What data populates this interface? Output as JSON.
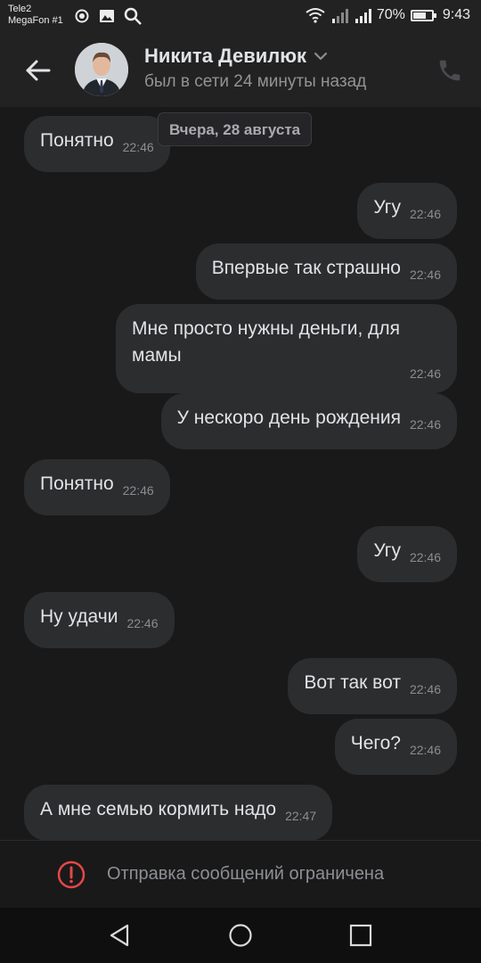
{
  "status_bar": {
    "carrier_1": "Tele2",
    "carrier_2": "MegaFon #1",
    "battery_percent": "70%",
    "battery_level": 0.7,
    "time": "9:43"
  },
  "header": {
    "contact_name": "Никита Девилюк",
    "last_seen": "был в сети 24 минуты назад"
  },
  "chat": {
    "date_chip": "Вчера, 28 августа",
    "messages": [
      {
        "side": "in",
        "text": "Понятно",
        "time": "22:46"
      },
      {
        "side": "out",
        "text": "Угу",
        "time": "22:46"
      },
      {
        "side": "out",
        "text": "Впервые так страшно",
        "time": "22:46"
      },
      {
        "side": "out",
        "text": "Мне просто нужны деньги, для мамы",
        "time": "22:46"
      },
      {
        "side": "out",
        "text": "У нескоро день рождения",
        "time": "22:46"
      },
      {
        "side": "in",
        "text": "Понятно",
        "time": "22:46"
      },
      {
        "side": "out",
        "text": "Угу",
        "time": "22:46"
      },
      {
        "side": "in",
        "text": "Ну удачи",
        "time": "22:46"
      },
      {
        "side": "out",
        "text": "Вот так вот",
        "time": "22:46"
      },
      {
        "side": "out",
        "text": "Чего?",
        "time": "22:46"
      },
      {
        "side": "in",
        "text": "А мне семью кормить надо",
        "time": "22:47"
      }
    ]
  },
  "restriction": {
    "text": "Отправка сообщений ограничена"
  },
  "colors": {
    "background": "#19191a",
    "bubble": "#2c2d2e",
    "alert_red": "#e64646"
  }
}
